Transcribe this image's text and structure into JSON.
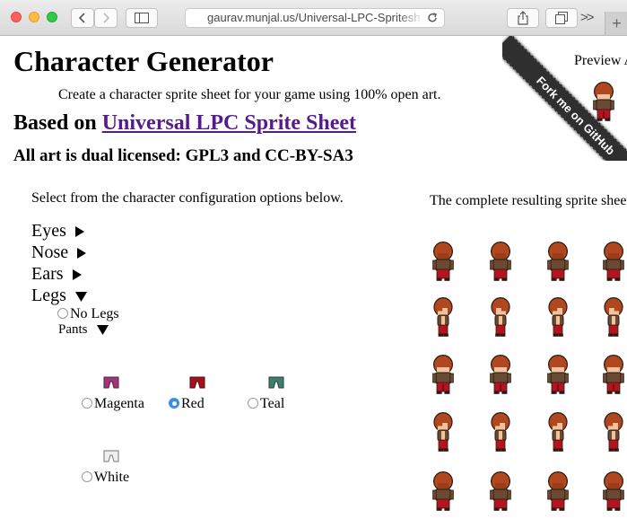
{
  "browser": {
    "url": "gaurav.munjal.us/Universal-LPC-Spritesh",
    "overflow_label": ">>",
    "new_tab_label": "+"
  },
  "page": {
    "title": "Character Generator",
    "tagline": "Create a character sprite sheet for your game using 100% open art.",
    "based_on_prefix": "Based on",
    "based_on_link": "Universal LPC Sprite Sheet",
    "license": "All art is dual licensed: GPL3 and CC-BY-SA3",
    "select_message": "Select from the character configuration options below.",
    "preview_label": "Preview A",
    "result_message": "The complete resulting sprite sheet",
    "ribbon_text": "Fork me on GitHub"
  },
  "options": [
    {
      "label": "Eyes",
      "state": "collapsed"
    },
    {
      "label": "Nose",
      "state": "collapsed"
    },
    {
      "label": "Ears",
      "state": "collapsed"
    },
    {
      "label": "Legs",
      "state": "expanded"
    }
  ],
  "legs": {
    "no_legs_label": "No Legs",
    "pants_label": "Pants",
    "colors": [
      {
        "label": "Magenta",
        "selected": false,
        "color": "#a0357a"
      },
      {
        "label": "Red",
        "selected": true,
        "color": "#a5121b"
      },
      {
        "label": "Teal",
        "selected": false,
        "color": "#3f7d6d"
      },
      {
        "label": "White",
        "selected": false,
        "color": "#d8d8d8"
      }
    ]
  },
  "sprite_colors": {
    "hair": "#b0471e",
    "shirt": "#6b4a35",
    "skin": "#f2c29c",
    "pants": "#b3141d",
    "outline": "#2a1a12"
  }
}
